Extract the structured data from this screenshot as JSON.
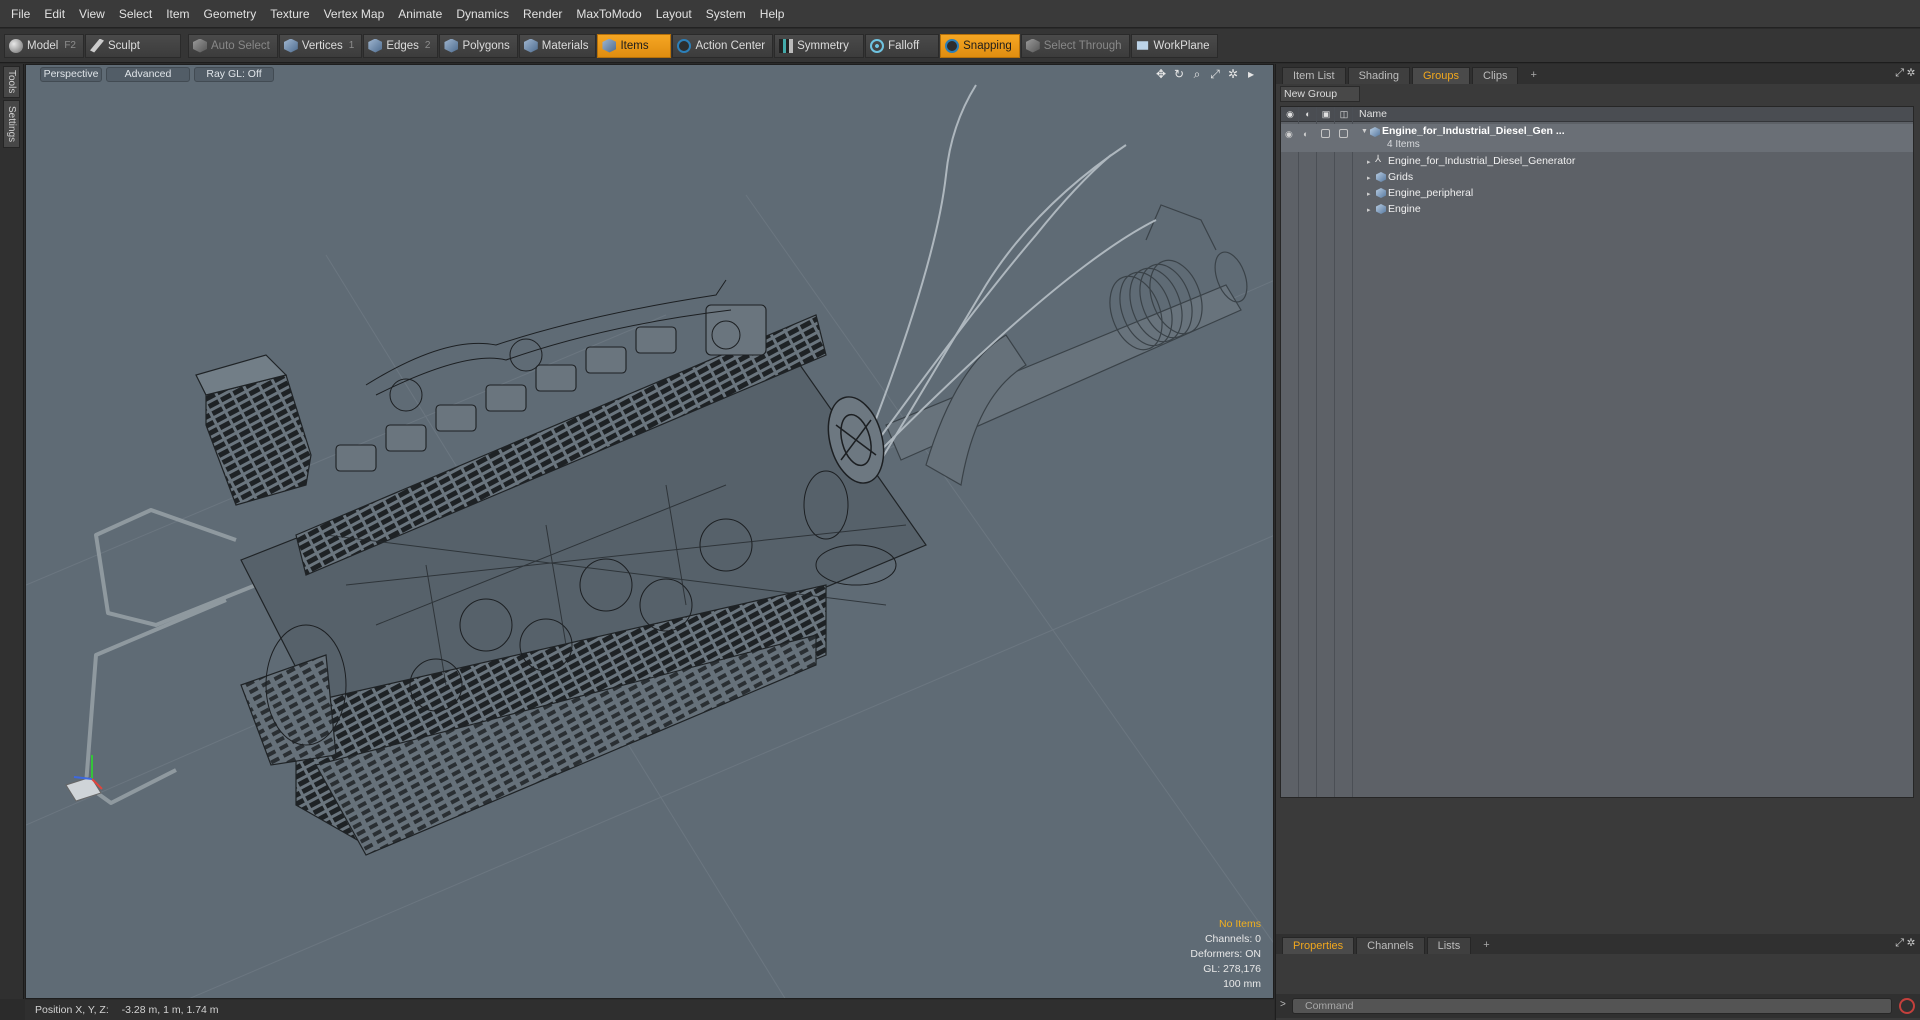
{
  "menu": [
    "File",
    "Edit",
    "View",
    "Select",
    "Item",
    "Geometry",
    "Texture",
    "Vertex Map",
    "Animate",
    "Dynamics",
    "Render",
    "MaxToModo",
    "Layout",
    "System",
    "Help"
  ],
  "toolbar": {
    "model": "Model",
    "model_key": "F2",
    "sculpt": "Sculpt",
    "auto_select": "Auto Select",
    "vertices": "Vertices",
    "vertices_key": "1",
    "edges": "Edges",
    "edges_key": "2",
    "polygons": "Polygons",
    "materials": "Materials",
    "items": "Items",
    "action_center": "Action Center",
    "symmetry": "Symmetry",
    "falloff": "Falloff",
    "snapping": "Snapping",
    "select_through": "Select Through",
    "workplane": "WorkPlane"
  },
  "left_tabs": [
    "Tools",
    "Settings"
  ],
  "viewport": {
    "view_mode": "Perspective",
    "shading": "Advanced",
    "raygl": "Ray GL: Off",
    "stats": {
      "selection": "No Items",
      "channels": "Channels: 0",
      "deformers": "Deformers: ON",
      "gl": "GL: 278,176",
      "scale": "100 mm"
    }
  },
  "status": {
    "label": "Position X, Y, Z:",
    "value": "-3.28 m, 1 m, 1.74 m"
  },
  "right_panel": {
    "top_tabs": [
      "Item List",
      "Shading",
      "Groups",
      "Clips"
    ],
    "active_top_tab": "Groups",
    "new_group": "New Group",
    "column_name": "Name",
    "group": {
      "name": "Engine_for_Industrial_Diesel_Gen ...",
      "count": "4 Items",
      "children": [
        "Engine_for_Industrial_Diesel_Generator",
        "Grids",
        "Engine_peripheral",
        "Engine"
      ]
    },
    "bottom_tabs": [
      "Properties",
      "Channels",
      "Lists"
    ],
    "command_placeholder": "Command"
  },
  "colors": {
    "accent": "#f2a81d",
    "viewport_bg": "#5f6b75",
    "wire": "#1f2326"
  }
}
